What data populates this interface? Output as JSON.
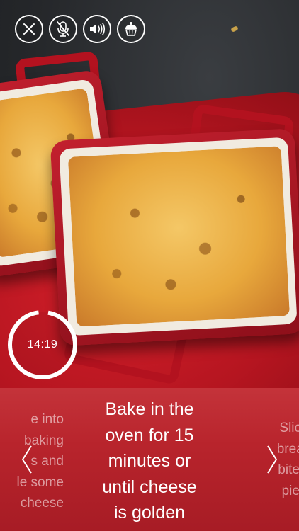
{
  "toolbar": {
    "buttons": [
      {
        "name": "close",
        "icon": "close-icon"
      },
      {
        "name": "mute-voice",
        "icon": "microphone-muted-icon"
      },
      {
        "name": "sound",
        "icon": "speaker-volume-icon"
      },
      {
        "name": "recipe",
        "icon": "cupcake-icon"
      }
    ]
  },
  "timer": {
    "time": "14:19",
    "ring_color": "#ffffff"
  },
  "steps": {
    "previous": "e into\nbaking\ns and\nle some\ncheese",
    "current": "Bake in the\noven for 15\nminutes or\nuntil cheese\nis golden",
    "next": "Slice\nbread\nbite s\npiec"
  },
  "nav": {
    "prev_icon": "chevron-left-icon",
    "next_icon": "chevron-right-icon"
  },
  "colors": {
    "panel_top": "#c4333a",
    "panel_bottom": "#a71c25",
    "text": "#ffffff"
  }
}
